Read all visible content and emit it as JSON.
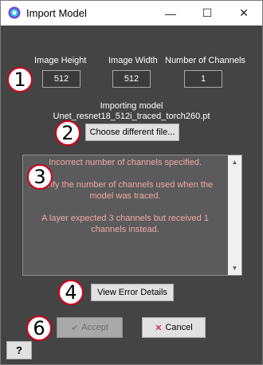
{
  "window": {
    "title": "Import Model",
    "minimize_glyph": "—",
    "maximize_glyph": "☐",
    "close_glyph": "✕"
  },
  "fields": {
    "image_height": {
      "label": "Image Height",
      "value": "512"
    },
    "image_width": {
      "label": "Image Width",
      "value": "512"
    },
    "num_channels": {
      "label": "Number of Channels",
      "value": "1"
    }
  },
  "importing": {
    "heading": "Importing model",
    "filename": "Unet_resnet18_512i_traced_torch260.pt",
    "choose_button": "Choose different file..."
  },
  "error": {
    "line1": "Incorrect number of channels specified.",
    "line2": "Verify the number of channels used when the model was traced.",
    "line3": "A layer expected 3 channels but received 1 channels instead."
  },
  "buttons": {
    "view_error": "View Error Details",
    "accept": "Accept",
    "accept_icon": "✔",
    "cancel": "Cancel",
    "cancel_icon": "✕",
    "help": "?"
  },
  "callouts": [
    "1",
    "2",
    "3",
    "4",
    "6"
  ],
  "colors": {
    "background": "#444444",
    "callout_border": "#d0021b",
    "error_text": "#f0a8a8"
  }
}
